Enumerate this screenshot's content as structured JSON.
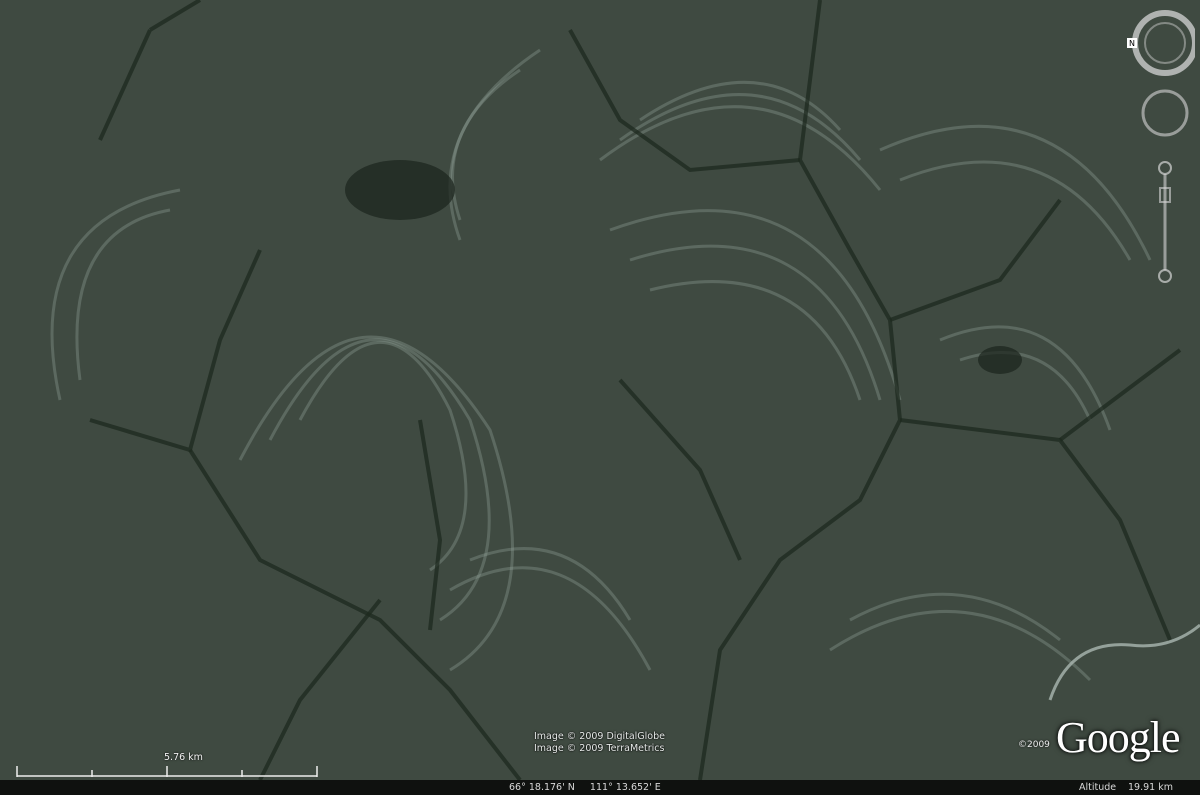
{
  "credits": {
    "line1": "Image © 2009 DigitalGlobe",
    "line2": "Image © 2009 TerraMetrics"
  },
  "scale": {
    "label": "5.76 km"
  },
  "status": {
    "coords": "66° 18.176' N     111° 13.652' E",
    "altitude_label": "Altitude",
    "altitude_value": "19.91 km"
  },
  "branding": {
    "copyright": "©2009",
    "logo": "Google"
  },
  "controls": {
    "compass_icon": "compass-ring-icon",
    "north_icon": "north-n-icon",
    "look_icon": "look-joystick-icon",
    "zoom_icon": "zoom-slider-icon"
  },
  "colors": {
    "terrain_base": "#3f4a40",
    "terrain_light": "#8a9a92",
    "drainage": "#1f2a20",
    "statusbar": "#0f110f"
  }
}
